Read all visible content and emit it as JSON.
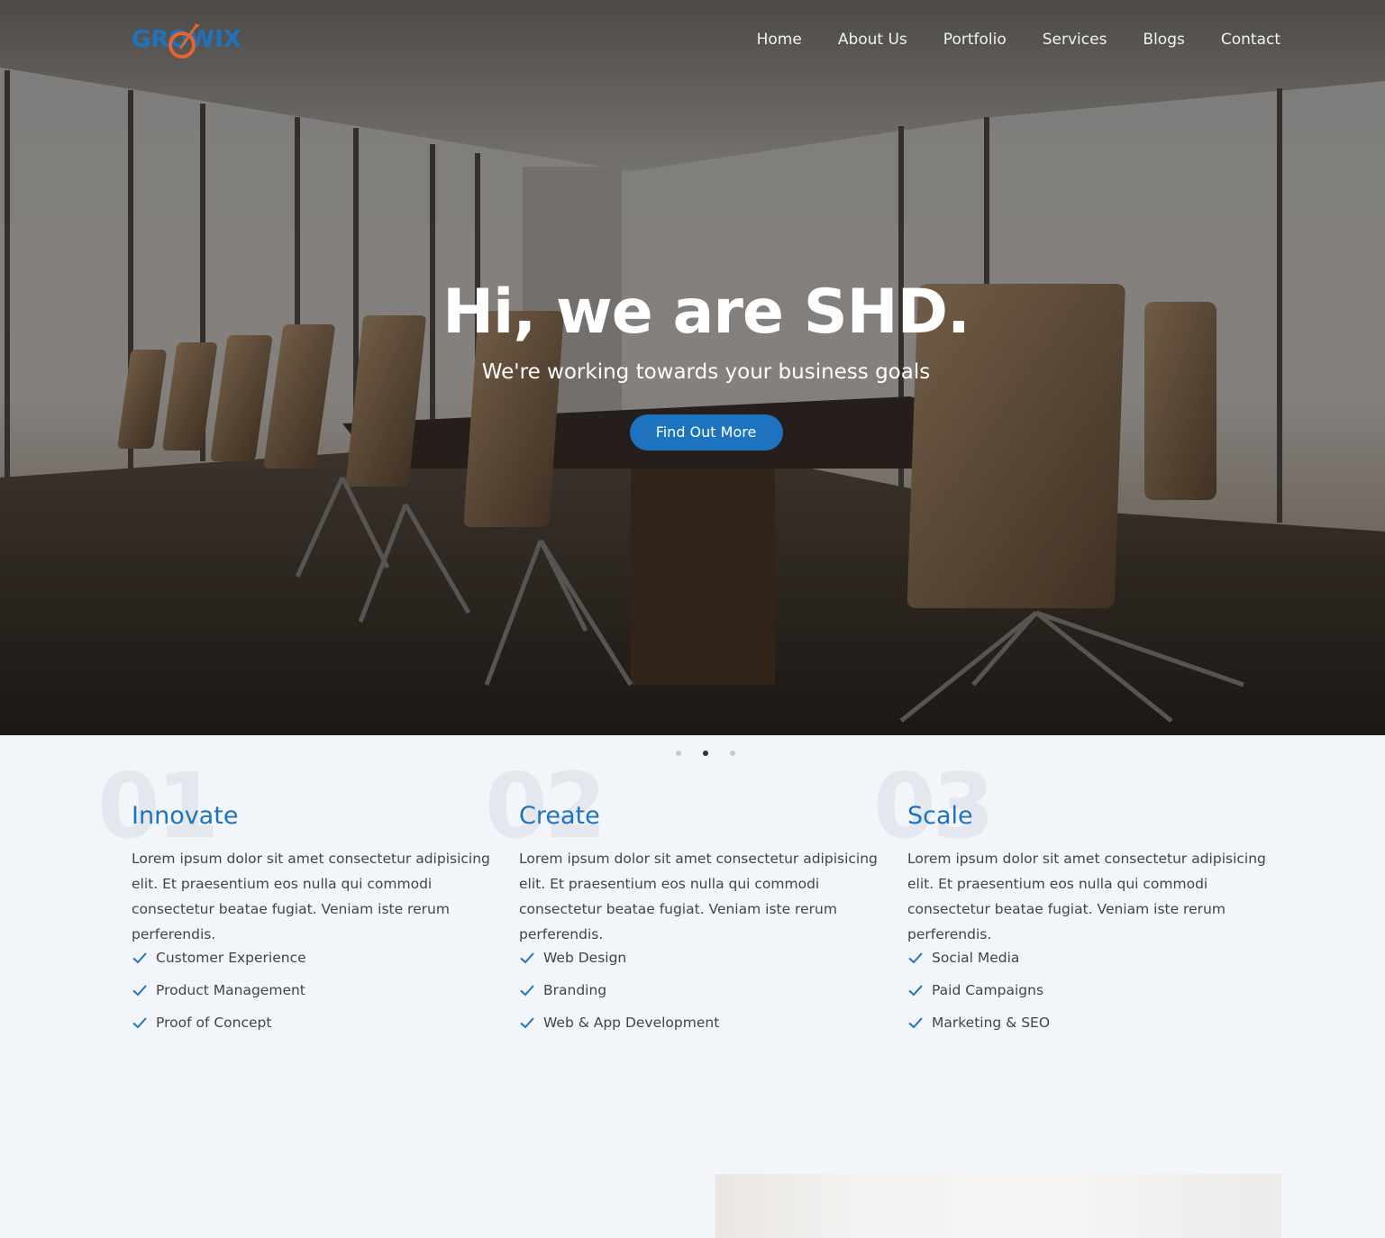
{
  "brand": {
    "logo_text": "GROWIX"
  },
  "nav": {
    "items": [
      {
        "label": "Home"
      },
      {
        "label": "About Us"
      },
      {
        "label": "Portfolio"
      },
      {
        "label": "Services"
      },
      {
        "label": "Blogs"
      },
      {
        "label": "Contact"
      }
    ]
  },
  "hero": {
    "title": "Hi, we are SHD.",
    "subtitle": "We're working towards your business goals",
    "button_label": "Find Out More",
    "background_image": "conference-room-photo"
  },
  "carousel": {
    "slide_count": 3,
    "active_index": 1
  },
  "features": [
    {
      "number": "01",
      "title": "Innovate",
      "text": "Lorem ipsum dolor sit amet consectetur adipisicing elit. Et praesentium eos nulla qui commodi consectetur beatae fugiat. Veniam iste rerum perferendis.",
      "items": [
        "Customer Experience",
        "Product Management",
        "Proof of Concept"
      ]
    },
    {
      "number": "02",
      "title": "Create",
      "text": "Lorem ipsum dolor sit amet consectetur adipisicing elit. Et praesentium eos nulla qui commodi consectetur beatae fugiat. Veniam iste rerum perferendis.",
      "items": [
        "Web Design",
        "Branding",
        "Web & App Development"
      ]
    },
    {
      "number": "03",
      "title": "Scale",
      "text": "Lorem ipsum dolor sit amet consectetur adipisicing elit. Et praesentium eos nulla qui commodi consectetur beatae fugiat. Veniam iste rerum perferendis.",
      "items": [
        "Social Media",
        "Paid Campaigns",
        "Marketing & SEO"
      ]
    }
  ],
  "icons": {
    "list_bullet": "check-icon"
  },
  "colors": {
    "accent": "#1e73be",
    "logo_accent": "#e8642c",
    "page_bg": "#f2f5f9"
  }
}
